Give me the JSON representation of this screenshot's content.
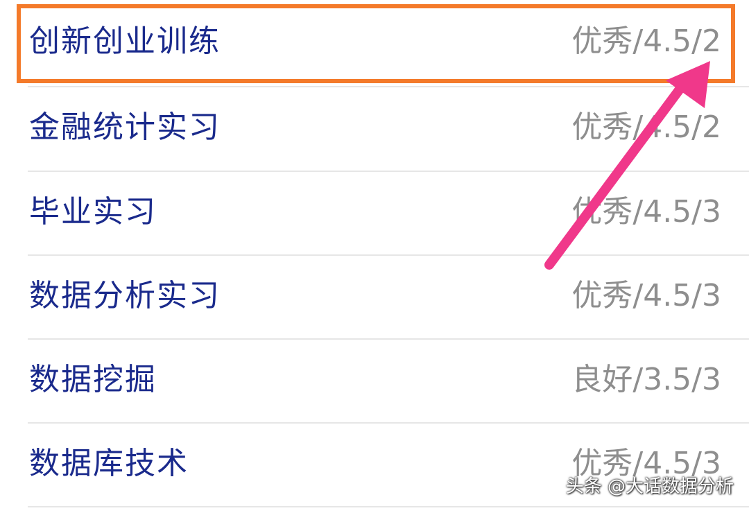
{
  "courses": [
    {
      "name": "创新创业训练",
      "grade": "优秀/4.5/2"
    },
    {
      "name": "金融统计实习",
      "grade": "优秀/4.5/2"
    },
    {
      "name": "毕业实习",
      "grade": "优秀/4.5/3"
    },
    {
      "name": "数据分析实习",
      "grade": "优秀/4.5/3"
    },
    {
      "name": "数据挖掘",
      "grade": "良好/3.5/3"
    },
    {
      "name": "数据库技术",
      "grade": "优秀/4.5/3"
    }
  ],
  "watermark": {
    "text": "头条 @大话数据分析",
    "icon": "chat-bubble-icon"
  },
  "colors": {
    "course_name": "#1a2a8c",
    "grade": "#8e8e8e",
    "highlight_box": "#f47a2a",
    "arrow": "#f0388a"
  }
}
